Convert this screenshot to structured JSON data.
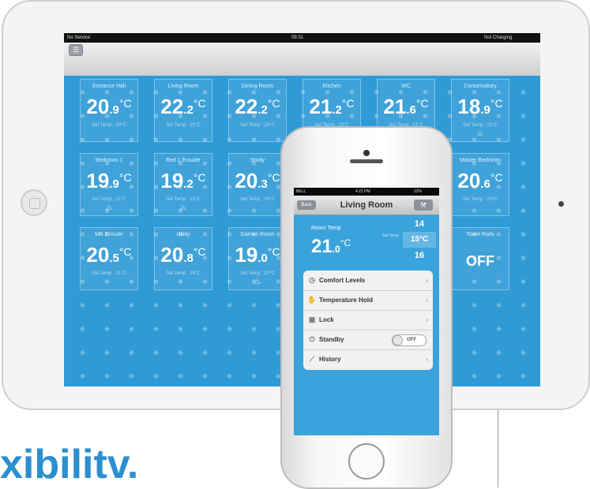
{
  "ipad": {
    "status": {
      "carrier": "No Service",
      "time": "09:31",
      "battery": "Not Charging"
    },
    "menu_icon": "menu-icon",
    "rooms": [
      {
        "name": "Entrance Hall",
        "temp_int": "20",
        "temp_dec": ".9",
        "unit": "°C",
        "set": "Set Temp : 20°C",
        "heating": false
      },
      {
        "name": "Living Room",
        "temp_int": "22",
        "temp_dec": ".2",
        "unit": "°C",
        "set": "Set Temp : 20°C",
        "heating": false
      },
      {
        "name": "Dining Room",
        "temp_int": "22",
        "temp_dec": ".2",
        "unit": "°C",
        "set": "Set Temp : 20°C",
        "heating": false
      },
      {
        "name": "Kitchen",
        "temp_int": "21",
        "temp_dec": ".2",
        "unit": "°C",
        "set": "Set Temp : 20°C",
        "heating": false
      },
      {
        "name": "WC",
        "temp_int": "21",
        "temp_dec": ".6",
        "unit": "°C",
        "set": "Set Temp : 21°C",
        "heating": false
      },
      {
        "name": "Conservatory",
        "temp_int": "18",
        "temp_dec": ".9",
        "unit": "°C",
        "set": "Set Temp : 21°C",
        "heating": true
      },
      {
        "name": "Bedroom 1",
        "temp_int": "19",
        "temp_dec": ".9",
        "unit": "°C",
        "set": "Set Temp : 21°C",
        "heating": true
      },
      {
        "name": "Bed 1 Ensuite",
        "temp_int": "19",
        "temp_dec": ".2",
        "unit": "°C",
        "set": "Set Temp : 21°C",
        "heating": true
      },
      {
        "name": "Study",
        "temp_int": "20",
        "temp_dec": ".3",
        "unit": "°C",
        "set": "Set Temp : 20°C",
        "heating": false
      },
      {
        "name": "Master Bedroom",
        "temp_int": "20",
        "temp_dec": ".6",
        "unit": "°C",
        "set": "Set Temp : 20°C",
        "heating": false
      },
      {
        "name": "MB Ensuite",
        "temp_int": "20",
        "temp_dec": ".5",
        "unit": "°C",
        "set": "Set Temp : 21°C",
        "heating": false
      },
      {
        "name": "Utility",
        "temp_int": "20",
        "temp_dec": ".8",
        "unit": "°C",
        "set": "Set Temp : 25°C",
        "heating": false
      },
      {
        "name": "Games Room",
        "temp_int": "19",
        "temp_dec": ".0",
        "unit": "°C",
        "set": "Set Temp : 20°C",
        "heating": true
      },
      {
        "name": "Towel Rails",
        "off_label": "OFF"
      }
    ]
  },
  "iphone": {
    "status": {
      "carrier": "BELL",
      "time": "4:21 PM",
      "battery": "22%"
    },
    "back_label": "Back",
    "title": "Living Room",
    "room_temp_label": "Room Temp",
    "temp_int": "21",
    "temp_dec": ".0",
    "unit": "°C",
    "set_temp_label": "Set Temp",
    "picker": [
      "14",
      "15°C",
      "16"
    ],
    "menu": [
      {
        "label": "Comfort Levels",
        "icon": "clock-icon"
      },
      {
        "label": "Temperature Hold",
        "icon": "hand-icon"
      },
      {
        "label": "Lock",
        "icon": "lock-icon"
      },
      {
        "label": "Standby",
        "icon": "power-icon",
        "toggle": "OFF"
      },
      {
        "label": "History",
        "icon": "chart-icon"
      }
    ]
  },
  "brand_text": "xibilitv."
}
